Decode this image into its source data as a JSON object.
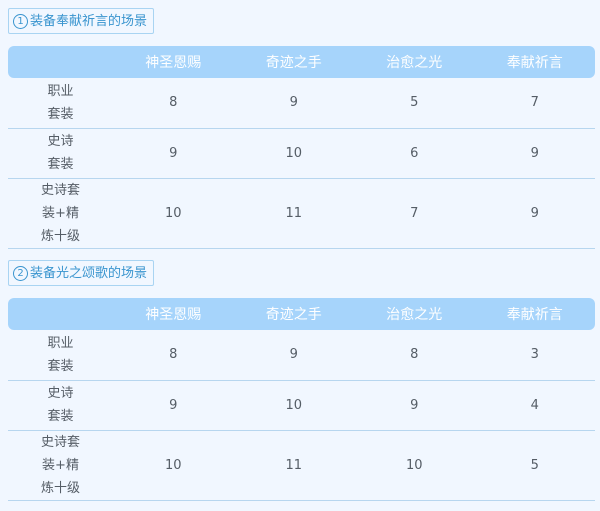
{
  "sections": [
    {
      "number": "1",
      "title": "装备奉献祈言的场景",
      "columns": [
        "",
        "神圣恩赐",
        "奇迹之手",
        "治愈之光",
        "奉献祈言"
      ],
      "rows": [
        {
          "label_lines": [
            "职业",
            "套装"
          ],
          "values": [
            "8",
            "9",
            "5",
            "7"
          ]
        },
        {
          "label_lines": [
            "史诗",
            "套装"
          ],
          "values": [
            "9",
            "10",
            "6",
            "9"
          ]
        },
        {
          "label_lines": [
            "史诗套",
            "装+精",
            "炼十级"
          ],
          "values": [
            "10",
            "11",
            "7",
            "9"
          ]
        }
      ]
    },
    {
      "number": "2",
      "title": "装备光之颂歌的场景",
      "columns": [
        "",
        "神圣恩赐",
        "奇迹之手",
        "治愈之光",
        "奉献祈言"
      ],
      "rows": [
        {
          "label_lines": [
            "职业",
            "套装"
          ],
          "values": [
            "8",
            "9",
            "8",
            "3"
          ]
        },
        {
          "label_lines": [
            "史诗",
            "套装"
          ],
          "values": [
            "9",
            "10",
            "9",
            "4"
          ]
        },
        {
          "label_lines": [
            "史诗套",
            "装+精",
            "炼十级"
          ],
          "values": [
            "10",
            "11",
            "10",
            "5"
          ]
        }
      ]
    }
  ],
  "colors": {
    "header_bg": "#a6d4fb",
    "tag_text": "#3a95cf",
    "page_bg": "#f1f7ff"
  }
}
